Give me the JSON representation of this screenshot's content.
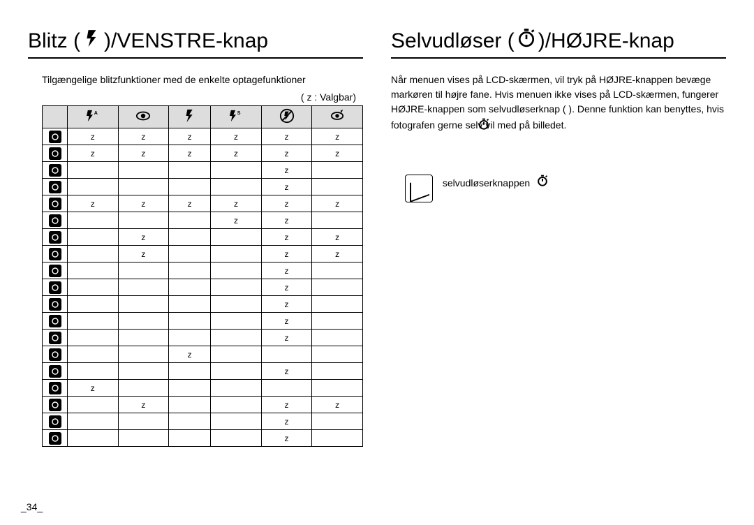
{
  "page_number": "_34_",
  "left": {
    "title_pre": "Blitz (",
    "title_post": ")/VENSTRE-knap",
    "subtitle": "Tilgængelige blitzfunktioner med de enkelte optagefunktioner",
    "legend": "( z : Valgbar)",
    "mark": "z"
  },
  "right": {
    "title_pre": "Selvudløser (",
    "title_post": ")/HØJRE-knap",
    "body": "Når menuen vises på LCD-skærmen, vil tryk på HØJRE-knappen bevæge markøren til højre fane. Hvis menuen ikke vises på LCD-skærmen, fungerer HØJRE-knappen som selvudløserknap (        ). Denne funktion kan benyttes, hvis fotografen gerne selv vil med på billedet.",
    "note_text": "selvudløserknappen"
  },
  "chart_data": {
    "type": "table",
    "columns": [
      "auto-flash",
      "red-eye",
      "fill-flash",
      "slow-sync",
      "flash-off",
      "red-eye-fix"
    ],
    "rows": [
      {
        "mode": "auto",
        "cells": [
          1,
          1,
          1,
          1,
          1,
          1
        ]
      },
      {
        "mode": "program",
        "cells": [
          1,
          1,
          1,
          1,
          1,
          1
        ]
      },
      {
        "mode": "dis",
        "cells": [
          0,
          0,
          0,
          0,
          1,
          0
        ]
      },
      {
        "mode": "movie",
        "cells": [
          0,
          0,
          0,
          0,
          1,
          0
        ]
      },
      {
        "mode": "photo-help",
        "cells": [
          1,
          1,
          1,
          1,
          1,
          1
        ]
      },
      {
        "mode": "night",
        "cells": [
          0,
          0,
          0,
          1,
          1,
          0
        ]
      },
      {
        "mode": "portrait",
        "cells": [
          0,
          1,
          0,
          0,
          1,
          1
        ]
      },
      {
        "mode": "children",
        "cells": [
          0,
          1,
          0,
          0,
          1,
          1
        ]
      },
      {
        "mode": "landscape",
        "cells": [
          0,
          0,
          0,
          0,
          1,
          0
        ]
      },
      {
        "mode": "text",
        "cells": [
          0,
          0,
          0,
          0,
          1,
          0
        ]
      },
      {
        "mode": "closeup",
        "cells": [
          0,
          0,
          0,
          0,
          1,
          0
        ]
      },
      {
        "mode": "sunset",
        "cells": [
          0,
          0,
          0,
          0,
          1,
          0
        ]
      },
      {
        "mode": "dawn",
        "cells": [
          0,
          0,
          0,
          0,
          1,
          0
        ]
      },
      {
        "mode": "backlight",
        "cells": [
          0,
          0,
          1,
          0,
          0,
          0
        ]
      },
      {
        "mode": "fireworks",
        "cells": [
          0,
          0,
          0,
          0,
          1,
          0
        ]
      },
      {
        "mode": "beach-snow",
        "cells": [
          1,
          0,
          0,
          0,
          0,
          0
        ]
      },
      {
        "mode": "self-shot",
        "cells": [
          0,
          1,
          0,
          0,
          1,
          1
        ]
      },
      {
        "mode": "food",
        "cells": [
          0,
          0,
          0,
          0,
          1,
          0
        ]
      },
      {
        "mode": "cafe",
        "cells": [
          0,
          0,
          0,
          0,
          1,
          0
        ]
      }
    ]
  }
}
